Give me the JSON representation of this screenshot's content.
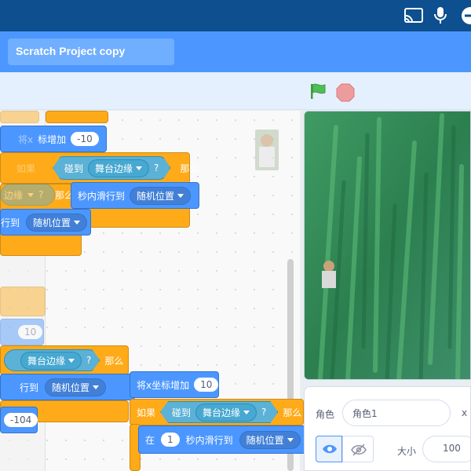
{
  "topbar": {
    "icons": [
      "cast-icon",
      "microphone-icon",
      "minus-icon"
    ]
  },
  "project": {
    "title": "Scratch Project copy"
  },
  "controls": {
    "green_flag": "green-flag-icon",
    "stop": "stop-icon"
  },
  "blocks": {
    "change_x_label": "将x坐标增加",
    "change_x_label_short": "将x",
    "change_x_suffix": "标增加",
    "change_x_value_top": "-10",
    "change_x_value_bottom": "10",
    "touching_label": "碰到",
    "touching_target": "舞台边缘",
    "touching_target_short": "边缘",
    "question": "?",
    "then": "那么",
    "if": "如果",
    "glide_prefix": "在",
    "glide_secs": "1",
    "glide_label": "秒内滑行到",
    "glide_target": "随机位置",
    "glide_tail": "行到",
    "ghost_value_1": "10",
    "ghost_value_2": "-104",
    "ghost_then": "那么",
    "ghost_if_then": "那么"
  },
  "sprite_info": {
    "sprite_label": "角色",
    "sprite_name": "角色1",
    "x_label": "x",
    "size_label": "大小",
    "size_value": "100"
  },
  "colors": {
    "menubar": "#4c97ff",
    "motion": "#4c97ff",
    "control": "#ffab19",
    "sensing": "#5cb1d6"
  }
}
